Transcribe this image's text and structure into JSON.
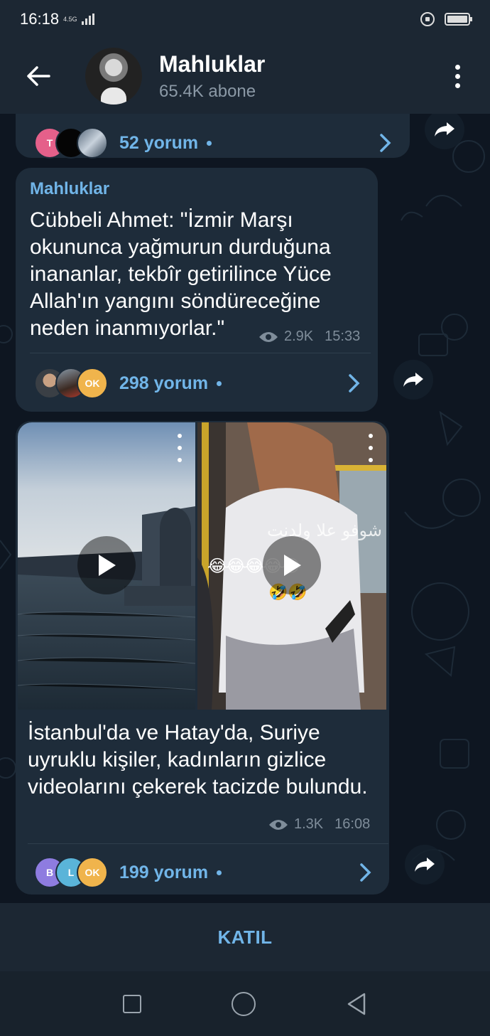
{
  "status_bar": {
    "time": "16:18",
    "network": "4.5G"
  },
  "header": {
    "channel_name": "Mahluklar",
    "subscribers": "65.4K abone"
  },
  "posts": [
    {
      "comments": {
        "label": "52 yorum",
        "avatar_initials": [
          "T",
          "",
          ""
        ]
      }
    },
    {
      "sender": "Mahluklar",
      "text": "Cübbeli Ahmet: \"İzmir Marşı okununca yağmurun durduğuna inananlar, tekbîr getirilince Yüce Allah'ın yangını söndüreceğine neden inanmıyorlar.\"",
      "views": "2.9K",
      "time": "15:33",
      "comments": {
        "label": "298 yorum",
        "avatar_initials": [
          "",
          "",
          "OK"
        ]
      }
    },
    {
      "text": "İstanbul'da ve Hatay'da, Suriye uyruklu kişiler, kadınların gizlice videolarını çekerek tacizde bulundu.",
      "views": "1.3K",
      "time": "16:08",
      "video_overlay_text": "شوفو علا ولدنت",
      "comments": {
        "label": "199 yorum",
        "avatar_initials": [
          "B",
          "L",
          "OK"
        ]
      }
    }
  ],
  "join_bar": {
    "label": "KATIL"
  },
  "colors": {
    "accent": "#71b5e8",
    "bubble": "#1e2c3a",
    "header": "#1c2733",
    "background": "#0e1621"
  }
}
